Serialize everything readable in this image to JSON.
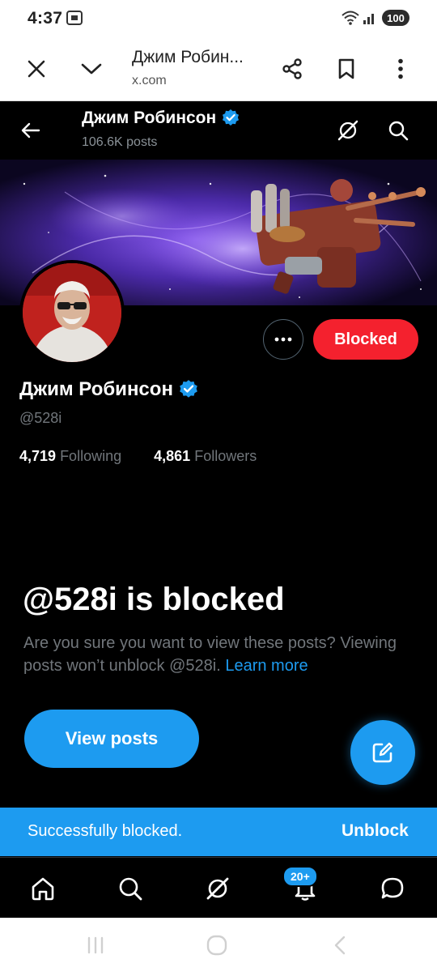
{
  "status_bar": {
    "time": "4:37",
    "battery": "100"
  },
  "browser": {
    "title": "Джим Робин...",
    "url": "x.com"
  },
  "header": {
    "name": "Джим Робинсон",
    "posts": "106.6K posts"
  },
  "profile": {
    "name": "Джим Робинсон",
    "handle": "@528i",
    "following_count": "4,719",
    "following_label": "Following",
    "followers_count": "4,861",
    "followers_label": "Followers",
    "blocked_label": "Blocked"
  },
  "blocked_notice": {
    "heading": "@528i is blocked",
    "description": "Are you sure you want to view these posts? Viewing posts won’t unblock @528i.",
    "learn_more": "Learn more",
    "view_posts": "View posts"
  },
  "toast": {
    "message": "Successfully blocked.",
    "action": "Unblock"
  },
  "bottom_nav": {
    "notifications_badge": "20+"
  },
  "colors": {
    "accent": "#1d9bf0",
    "blocked": "#f4212e",
    "background": "#000000"
  }
}
